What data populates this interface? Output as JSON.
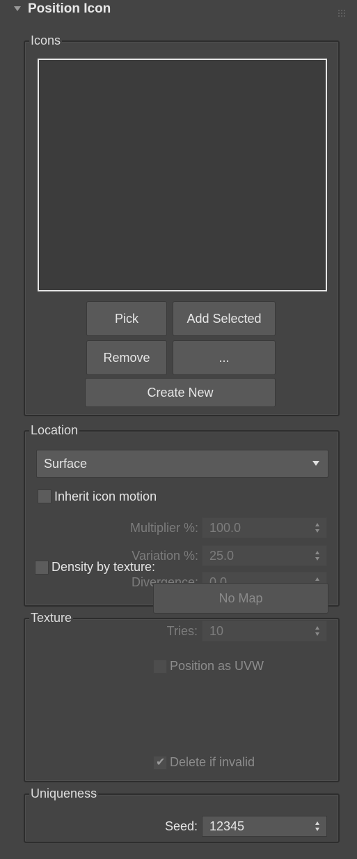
{
  "rollout": {
    "title": "Position Icon"
  },
  "icons": {
    "label": "Icons",
    "buttons": {
      "pick": "Pick",
      "add_selected": "Add Selected",
      "remove": "Remove",
      "more": "...",
      "create_new": "Create New"
    }
  },
  "location": {
    "label": "Location",
    "mode": "Surface",
    "inherit_label": "Inherit icon motion",
    "inherit_checked": false,
    "multiplier": {
      "label": "Multiplier %:",
      "value": "100.0"
    },
    "variation": {
      "label": "Variation %:",
      "value": "25.0"
    },
    "divergence": {
      "label": "Divergence:",
      "value": "0.0"
    }
  },
  "texture": {
    "label": "Texture",
    "density_label": "Density by texture:",
    "density_checked": false,
    "map_button": "No Map",
    "tries": {
      "label": "Tries:",
      "value": "10"
    },
    "position_uvw_label": "Position as UVW",
    "position_uvw_checked": false,
    "delete_invalid_label": "Delete if invalid",
    "delete_invalid_checked": true
  },
  "uniqueness": {
    "label": "Uniqueness",
    "seed": {
      "label": "Seed:",
      "value": "12345"
    }
  }
}
